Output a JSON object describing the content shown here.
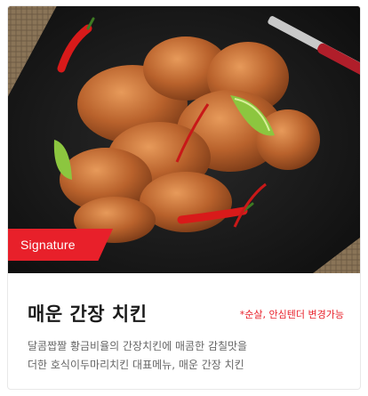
{
  "badge": {
    "label": "Signature"
  },
  "menu": {
    "title": "매운 간장 치킨",
    "note": "*순살, 안심텐더 변경가능",
    "description_line1": "달콤짭짤 황금비율의 간장치킨에 매콤한 감칠맛을",
    "description_line2": "더한 호식이두마리치킨 대표메뉴, 매운 간장 치킨"
  },
  "colors": {
    "accent": "#e8202a",
    "title": "#1a1a1a",
    "description": "#666666"
  }
}
